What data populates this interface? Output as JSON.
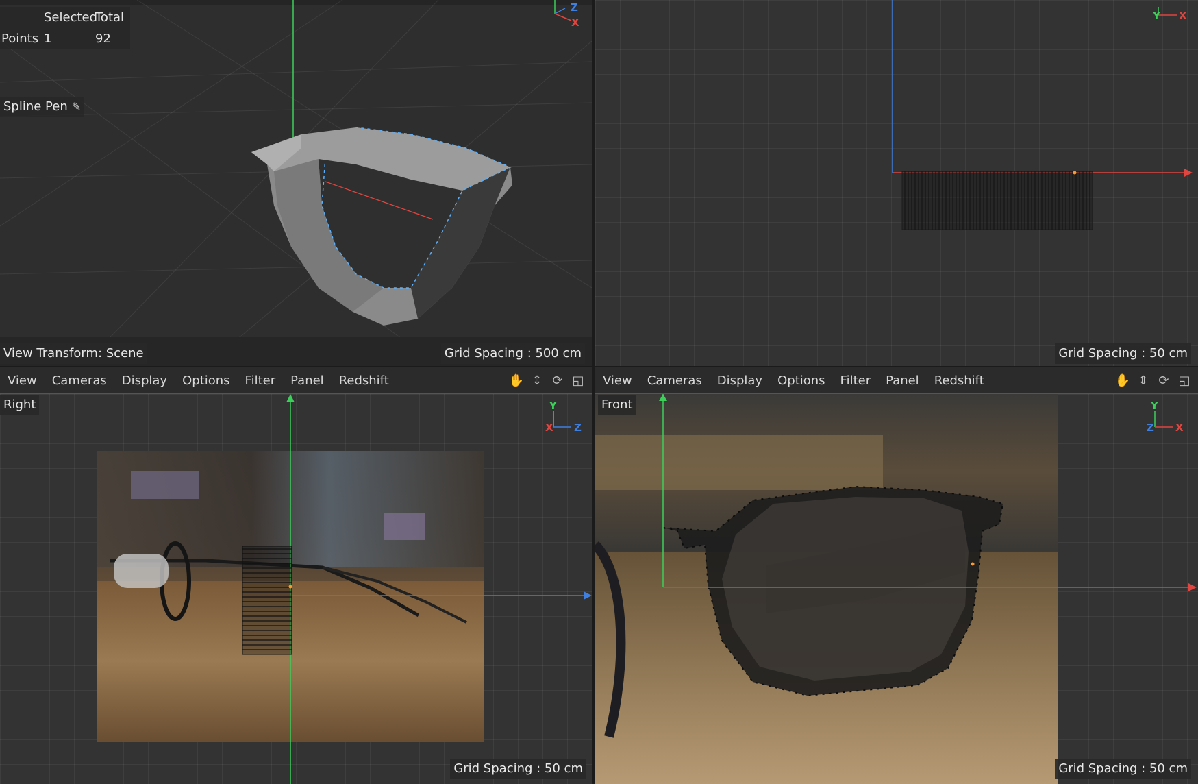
{
  "hud": {
    "col_selected": "Selected",
    "col_total": "Total",
    "row_label": "Points",
    "selected": "1",
    "total": "92"
  },
  "tool_label": "Spline Pen",
  "perspective": {
    "view_transform": "View Transform: Scene",
    "grid_spacing": "Grid Spacing : 500 cm"
  },
  "top_view": {
    "grid_spacing": "Grid Spacing : 50 cm"
  },
  "right_view": {
    "name": "Right",
    "grid_spacing": "Grid Spacing : 50 cm"
  },
  "front_view": {
    "name": "Front",
    "grid_spacing": "Grid Spacing : 50 cm"
  },
  "menu": {
    "items": [
      "View",
      "Cameras",
      "Display",
      "Options",
      "Filter",
      "Panel",
      "Redshift"
    ],
    "icons": [
      "hand-pan-icon",
      "move-icon",
      "rotate-icon",
      "maximize-icon"
    ]
  },
  "axes": {
    "x": "X",
    "y": "Y",
    "z": "Z"
  },
  "colors": {
    "x_axis": "#e0453f",
    "y_axis": "#3ccf5a",
    "z_axis": "#3f7fe0",
    "viewport_bg": "#333333"
  }
}
